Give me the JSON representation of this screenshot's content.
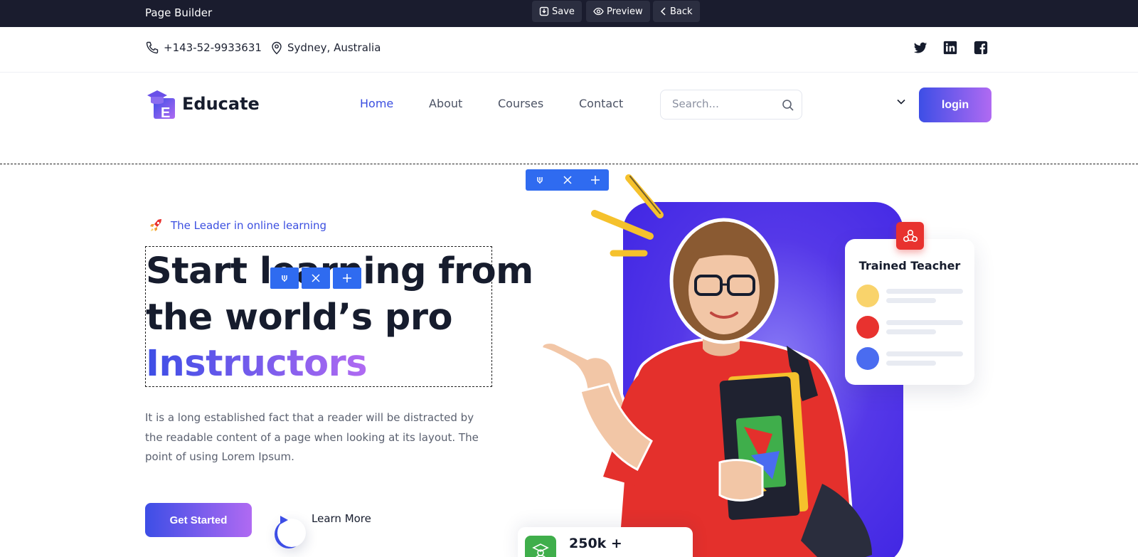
{
  "builder": {
    "title": "Page Builder",
    "save_label": "Save",
    "preview_label": "Preview",
    "back_label": "Back"
  },
  "topbar": {
    "phone": "+143-52-9933631",
    "location": "Sydney, Australia",
    "social": [
      "twitter-icon",
      "linkedin-icon",
      "facebook-icon"
    ]
  },
  "nav": {
    "brand": "Educate",
    "links": [
      "Home",
      "About",
      "Courses",
      "Contact"
    ],
    "active": "Home",
    "search_placeholder": "Search...",
    "login_label": "login"
  },
  "hero": {
    "tagline": "The Leader in online learning",
    "headline_line1": "Start learning from",
    "headline_line2": "the world’s pro",
    "headline_accent": "Instructors",
    "description": "It is a long established fact that a reader will be distracted by the readable content of a page when looking at its layout. The point of using Lorem Ipsum.",
    "cta_label": "Get Started",
    "learn_more_label": "Learn More"
  },
  "cards": {
    "teacher_title": "Trained Teacher",
    "teacher_dots": [
      "#f9d36b",
      "#e8322f",
      "#4a6cf0"
    ],
    "stat_value": "250k +"
  },
  "colors": {
    "accent": "#3b4fe0",
    "gradient_start": "#3d4ee6",
    "gradient_end": "#b06af2",
    "builder_bar": "#1a1c2e",
    "edit_tool": "#2f6bf0"
  }
}
